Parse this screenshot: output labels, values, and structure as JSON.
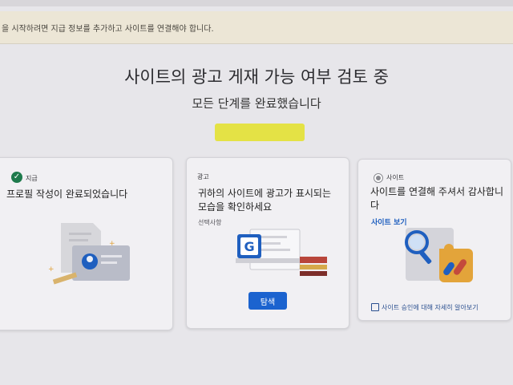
{
  "banner": {
    "text": "을 시작하려면 지급 정보를 추가하고 사이트를 연결해야 합니다."
  },
  "header": {
    "title": "사이트의 광고 게재 가능 여부 검토 중",
    "subtitle": "모든 단계를 완료했습니다"
  },
  "cards": [
    {
      "tag": "지급",
      "status_icon": "check-circle-icon",
      "heading": "프로필 작성이 완료되었습니다"
    },
    {
      "tag": "광고",
      "heading_line1": "귀하의 사이트에 광고가 표시되는",
      "heading_line2": "모습을 확인하세요",
      "optional": "선택사항",
      "button_label": "탐색",
      "g_letter": "G"
    },
    {
      "tag": "사이트",
      "status_icon": "radio-icon",
      "heading_line1": "사이트를 연결해 주셔서 감사합니",
      "heading_line2": "다",
      "link": "사이트 보기",
      "footer_link": "사이트 승인에 대해 자세히 알아보기"
    }
  ],
  "colors": {
    "accent": "#1b63cf",
    "success": "#1e7a4c",
    "highlight": "#e4e236",
    "banner_bg": "#ece6d6"
  }
}
